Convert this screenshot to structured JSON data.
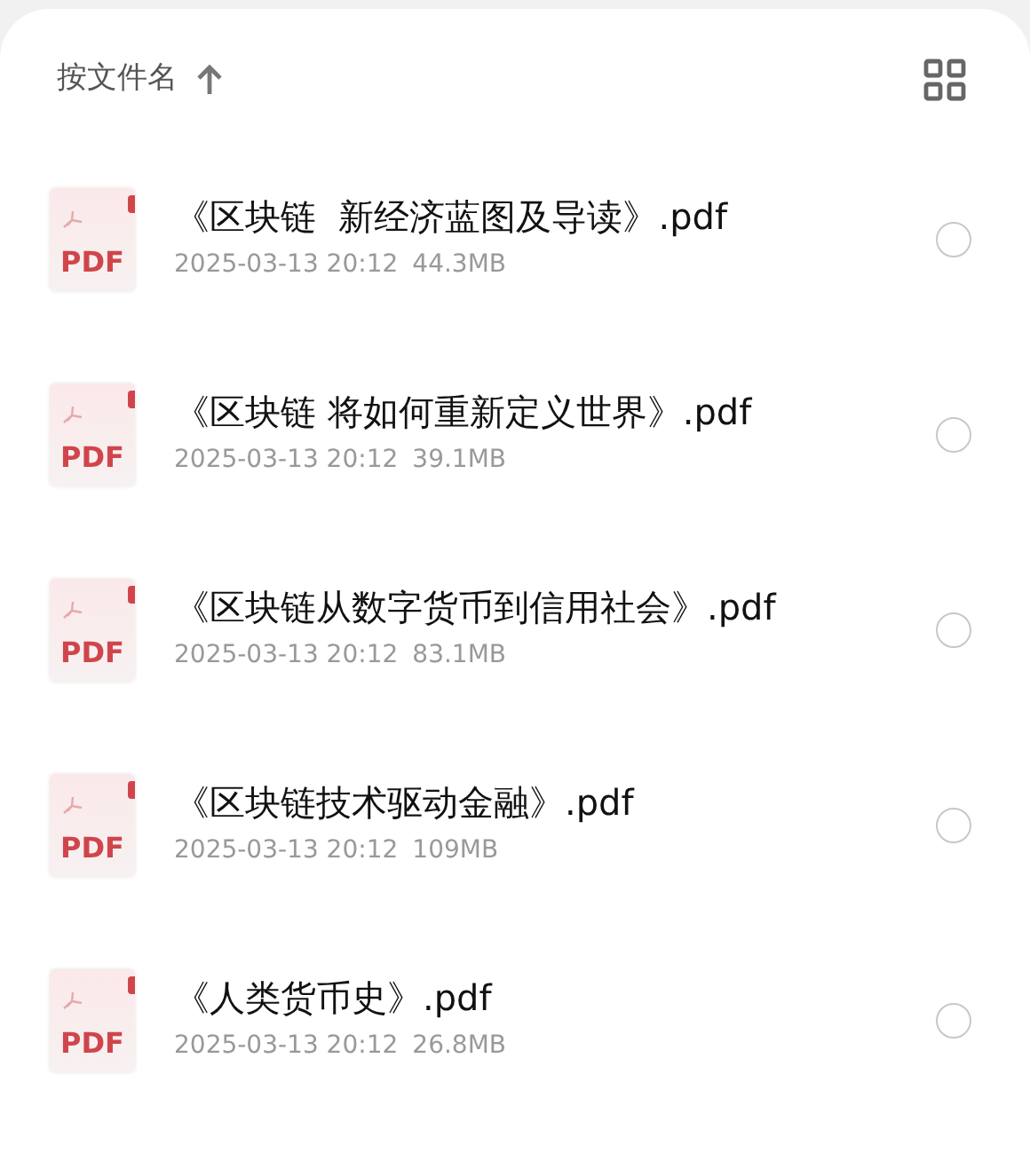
{
  "header": {
    "sort_label": "按文件名"
  },
  "files": [
    {
      "name": "《区块链  新经济蓝图及导读》.pdf",
      "date": "2025-03-13 20:12",
      "size": "44.3MB",
      "icon_label": "PDF",
      "selected": false
    },
    {
      "name": "《区块链 将如何重新定义世界》.pdf",
      "date": "2025-03-13 20:12",
      "size": "39.1MB",
      "icon_label": "PDF",
      "selected": false
    },
    {
      "name": "《区块链从数字货币到信用社会》.pdf",
      "date": "2025-03-13 20:12",
      "size": "83.1MB",
      "icon_label": "PDF",
      "selected": false
    },
    {
      "name": "《区块链技术驱动金融》.pdf",
      "date": "2025-03-13 20:12",
      "size": "109MB",
      "icon_label": "PDF",
      "selected": false
    },
    {
      "name": "《人类货币史》.pdf",
      "date": "2025-03-13 20:12",
      "size": "26.8MB",
      "icon_label": "PDF",
      "selected": false
    }
  ]
}
